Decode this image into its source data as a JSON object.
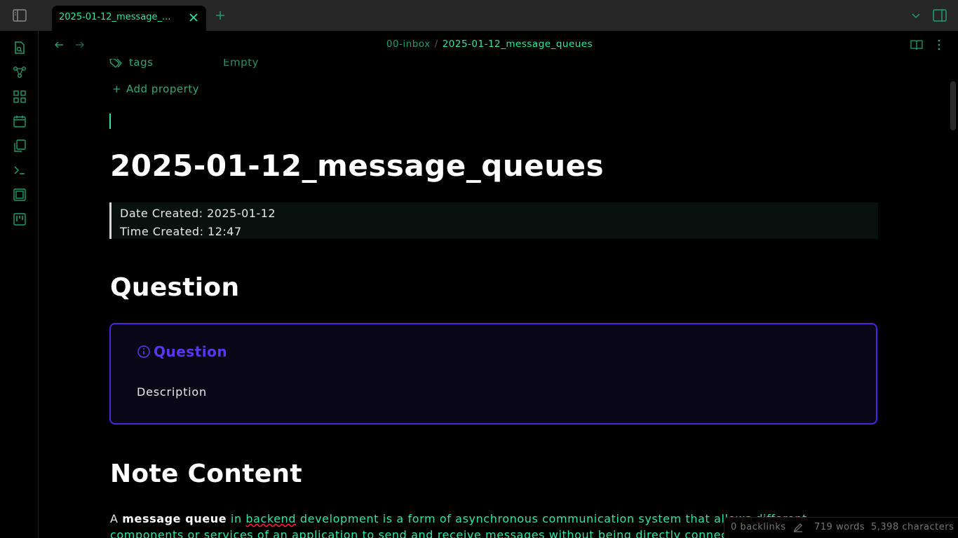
{
  "tab": {
    "title": "2025-01-12_message_..."
  },
  "breadcrumb": {
    "folder": "00-inbox",
    "separator": "/",
    "file": "2025-01-12_message_queues"
  },
  "properties": {
    "tags_key": "tags",
    "tags_value": "Empty",
    "add_label": "Add property"
  },
  "note": {
    "title": "2025-01-12_message_queues",
    "date_created": "Date Created: 2025-01-12",
    "time_created": "Time Created: 12:47",
    "heading_question": "Question",
    "callout_title": "Question",
    "callout_body": "Description",
    "heading_content": "Note Content",
    "para_line1": {
      "a": "A ",
      "bold": "message queue",
      "b": " in ",
      "misspelled": "backend",
      "c": " development is a form of asynchronous communication system that allows different"
    },
    "para_line2": "components or services of an application to send and receive messages without being directly connected"
  },
  "status": {
    "backlinks": "0 backlinks",
    "words": "719 words",
    "characters": "5,398 characters"
  },
  "colors": {
    "accent": "#2ee6a6",
    "callout_border": "#4a26e0",
    "callout_title": "#5a36f0"
  },
  "icons": [
    "sidebar-toggle-icon",
    "close-icon",
    "plus-icon",
    "chevron-down-icon",
    "right-sidebar-icon",
    "file-search-icon",
    "graph-icon",
    "blocks-icon",
    "calendar-icon",
    "copy-icon",
    "terminal-icon",
    "layers-icon",
    "kanban-icon",
    "arrow-left-icon",
    "arrow-right-icon",
    "book-open-icon",
    "more-vertical-icon",
    "tags-icon",
    "info-icon",
    "pencil-icon"
  ]
}
